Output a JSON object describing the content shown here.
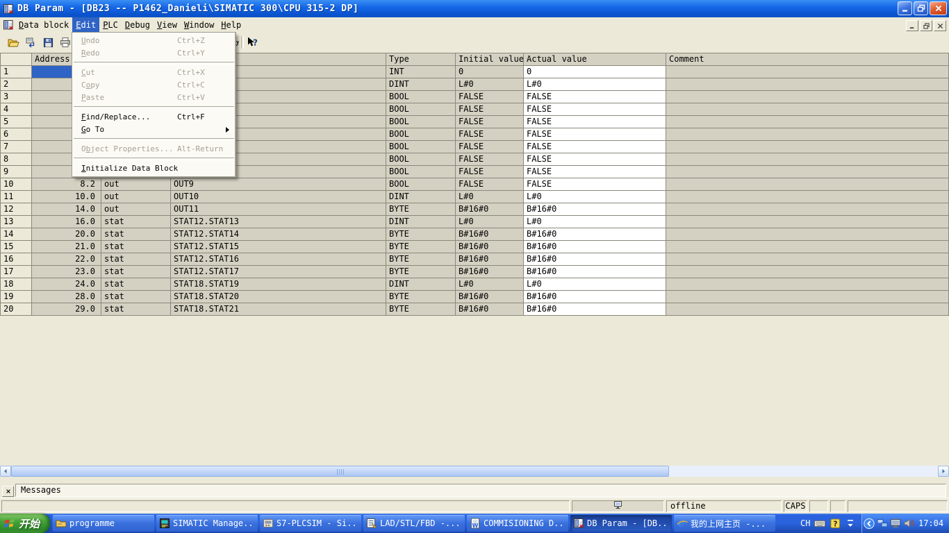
{
  "window": {
    "title": "DB Param - [DB23 -- P1462_Danieli\\SIMATIC 300\\CPU 315-2 DP]",
    "app_icon": "db-param"
  },
  "menu_bar": {
    "items": [
      {
        "label": "Data block",
        "underline": 0
      },
      {
        "label": "Edit",
        "underline": 0,
        "selected": true
      },
      {
        "label": "PLC",
        "underline": 0
      },
      {
        "label": "Debug",
        "underline": 0
      },
      {
        "label": "View",
        "underline": 0
      },
      {
        "label": "Window",
        "underline": 0
      },
      {
        "label": "Help",
        "underline": 0
      }
    ]
  },
  "toolbar": {
    "buttons": [
      {
        "name": "open",
        "icon": "open-folder"
      },
      {
        "name": "download",
        "icon": "download"
      },
      {
        "name": "save",
        "icon": "save"
      },
      {
        "name": "print",
        "icon": "print"
      },
      {
        "name": "monitor",
        "icon": "glasses"
      },
      {
        "name": "help",
        "icon": "help-arrow"
      }
    ]
  },
  "edit_menu": {
    "items": [
      {
        "label": "Undo",
        "underline": 0,
        "shortcut": "Ctrl+Z",
        "enabled": false
      },
      {
        "label": "Redo",
        "underline": 0,
        "shortcut": "Ctrl+Y",
        "enabled": false
      },
      {
        "separator": true
      },
      {
        "label": "Cut",
        "underline": 0,
        "shortcut": "Ctrl+X",
        "enabled": false
      },
      {
        "label": "Copy",
        "underline": 1,
        "shortcut": "Ctrl+C",
        "enabled": false
      },
      {
        "label": "Paste",
        "underline": 0,
        "shortcut": "Ctrl+V",
        "enabled": false
      },
      {
        "separator": true
      },
      {
        "label": "Find/Replace...",
        "underline": 0,
        "shortcut": "Ctrl+F",
        "enabled": true
      },
      {
        "label": "Go To",
        "underline": 0,
        "shortcut": "",
        "enabled": true,
        "submenu": true
      },
      {
        "separator": true
      },
      {
        "label": "Object Properties...",
        "underline": 1,
        "shortcut": "Alt-Return",
        "enabled": false
      },
      {
        "separator": true
      },
      {
        "label": "Initialize Data Block",
        "underline": 0,
        "shortcut": "",
        "enabled": true
      }
    ]
  },
  "table": {
    "headers": {
      "num": "",
      "address": "Address",
      "declaration": "",
      "name": "",
      "type": "Type",
      "initial": "Initial value",
      "actual": "Actual value",
      "comment": "Comment"
    },
    "rows": [
      {
        "n": "1",
        "address": "",
        "decl": "",
        "name": "",
        "type": "INT",
        "init": "0",
        "actual": "0",
        "comment": "",
        "selected": true
      },
      {
        "n": "2",
        "address": "",
        "decl": "",
        "name": "",
        "type": "DINT",
        "init": "L#0",
        "actual": "L#0",
        "comment": ""
      },
      {
        "n": "3",
        "address": "",
        "decl": "",
        "name": "",
        "type": "BOOL",
        "init": "FALSE",
        "actual": "FALSE",
        "comment": ""
      },
      {
        "n": "4",
        "address": "",
        "decl": "",
        "name": "",
        "type": "BOOL",
        "init": "FALSE",
        "actual": "FALSE",
        "comment": ""
      },
      {
        "n": "5",
        "address": "",
        "decl": "",
        "name": "",
        "type": "BOOL",
        "init": "FALSE",
        "actual": "FALSE",
        "comment": ""
      },
      {
        "n": "6",
        "address": "",
        "decl": "",
        "name": "",
        "type": "BOOL",
        "init": "FALSE",
        "actual": "FALSE",
        "comment": ""
      },
      {
        "n": "7",
        "address": "",
        "decl": "",
        "name": "",
        "type": "BOOL",
        "init": "FALSE",
        "actual": "FALSE",
        "comment": ""
      },
      {
        "n": "8",
        "address": "",
        "decl": "",
        "name": "",
        "type": "BOOL",
        "init": "FALSE",
        "actual": "FALSE",
        "comment": ""
      },
      {
        "n": "9",
        "address": "",
        "decl": "",
        "name": "",
        "type": "BOOL",
        "init": "FALSE",
        "actual": "FALSE",
        "comment": ""
      },
      {
        "n": "10",
        "address": "8.2",
        "decl": "out",
        "name": "OUT9",
        "type": "BOOL",
        "init": "FALSE",
        "actual": "FALSE",
        "comment": ""
      },
      {
        "n": "11",
        "address": "10.0",
        "decl": "out",
        "name": "OUT10",
        "type": "DINT",
        "init": "L#0",
        "actual": "L#0",
        "comment": ""
      },
      {
        "n": "12",
        "address": "14.0",
        "decl": "out",
        "name": "OUT11",
        "type": "BYTE",
        "init": "B#16#0",
        "actual": "B#16#0",
        "comment": ""
      },
      {
        "n": "13",
        "address": "16.0",
        "decl": "stat",
        "name": "STAT12.STAT13",
        "type": "DINT",
        "init": "L#0",
        "actual": "L#0",
        "comment": ""
      },
      {
        "n": "14",
        "address": "20.0",
        "decl": "stat",
        "name": "STAT12.STAT14",
        "type": "BYTE",
        "init": "B#16#0",
        "actual": "B#16#0",
        "comment": ""
      },
      {
        "n": "15",
        "address": "21.0",
        "decl": "stat",
        "name": "STAT12.STAT15",
        "type": "BYTE",
        "init": "B#16#0",
        "actual": "B#16#0",
        "comment": ""
      },
      {
        "n": "16",
        "address": "22.0",
        "decl": "stat",
        "name": "STAT12.STAT16",
        "type": "BYTE",
        "init": "B#16#0",
        "actual": "B#16#0",
        "comment": ""
      },
      {
        "n": "17",
        "address": "23.0",
        "decl": "stat",
        "name": "STAT12.STAT17",
        "type": "BYTE",
        "init": "B#16#0",
        "actual": "B#16#0",
        "comment": ""
      },
      {
        "n": "18",
        "address": "24.0",
        "decl": "stat",
        "name": "STAT18.STAT19",
        "type": "DINT",
        "init": "L#0",
        "actual": "L#0",
        "comment": ""
      },
      {
        "n": "19",
        "address": "28.0",
        "decl": "stat",
        "name": "STAT18.STAT20",
        "type": "BYTE",
        "init": "B#16#0",
        "actual": "B#16#0",
        "comment": ""
      },
      {
        "n": "20",
        "address": "29.0",
        "decl": "stat",
        "name": "STAT18.STAT21",
        "type": "BYTE",
        "init": "B#16#0",
        "actual": "B#16#0",
        "comment": ""
      }
    ]
  },
  "messages_panel": {
    "label": "Messages"
  },
  "status_bar": {
    "connection": "offline",
    "keyboard_state": "CAPS"
  },
  "taskbar": {
    "start_label": "开始",
    "buttons": [
      {
        "label": "programme",
        "icon": "folder"
      },
      {
        "label": "SIMATIC Manage...",
        "icon": "simatic"
      },
      {
        "label": "S7-PLCSIM - Si...",
        "icon": "plcsim"
      },
      {
        "label": "LAD/STL/FBD  -...",
        "icon": "lad"
      },
      {
        "label": "COMMISIONING D...",
        "icon": "word"
      },
      {
        "label": "DB Param - [DB...",
        "icon": "db-param",
        "active": true
      },
      {
        "label": "我的上网主页 -...",
        "icon": "ie"
      }
    ],
    "language": "CH",
    "time": "17:04"
  },
  "colors": {
    "titlebar_blue": "#1668e8",
    "selection_blue": "#2f63c5",
    "panel_beige": "#ece9d8",
    "cell_gray": "#d5d1c2",
    "taskbar_blue": "#2a63dd",
    "start_green": "#48a43c"
  }
}
